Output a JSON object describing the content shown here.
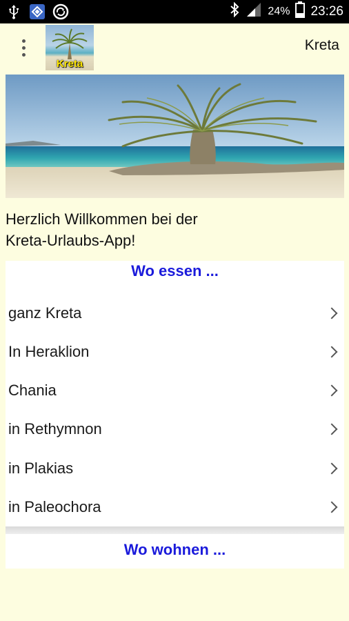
{
  "status_bar": {
    "battery_percent": "24%",
    "time": "23:26",
    "icons": [
      "usb-icon",
      "app-store-icon",
      "sync-icon",
      "bluetooth-icon",
      "signal-icon",
      "battery-icon"
    ]
  },
  "app_bar": {
    "title": "Kreta",
    "logo_text": "Kreta",
    "menu_icon": "overflow-menu-icon"
  },
  "welcome": {
    "line1": "Herzlich Willkommen bei der",
    "line2": "Kreta-Urlaubs-App!"
  },
  "section_essen": {
    "title": "Wo essen ...",
    "items": [
      {
        "label": "ganz Kreta"
      },
      {
        "label": "In Heraklion"
      },
      {
        "label": "Chania"
      },
      {
        "label": "in Rethymnon"
      },
      {
        "label": "in Plakias"
      },
      {
        "label": "in Paleochora"
      }
    ]
  },
  "section_wohnen": {
    "title": "Wo wohnen ..."
  },
  "colors": {
    "background": "#fdfde0",
    "section_title": "#1a1adb",
    "logo_text": "#ffe600"
  }
}
